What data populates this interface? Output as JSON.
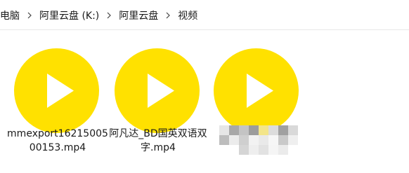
{
  "breadcrumb": {
    "items": [
      "电脑",
      "阿里云盘 (K:)",
      "阿里云盘",
      "视频"
    ]
  },
  "files": [
    {
      "name": "mmexport1621500500153.mp4",
      "icon": "video-play-icon"
    },
    {
      "name": "阿凡达_BD国英双语双字.mp4",
      "icon": "video-play-icon"
    },
    {
      "name": "",
      "icon": "video-play-icon"
    }
  ],
  "colors": {
    "thumb_yellow": "#ffe100",
    "play_white": "#ffffff"
  }
}
